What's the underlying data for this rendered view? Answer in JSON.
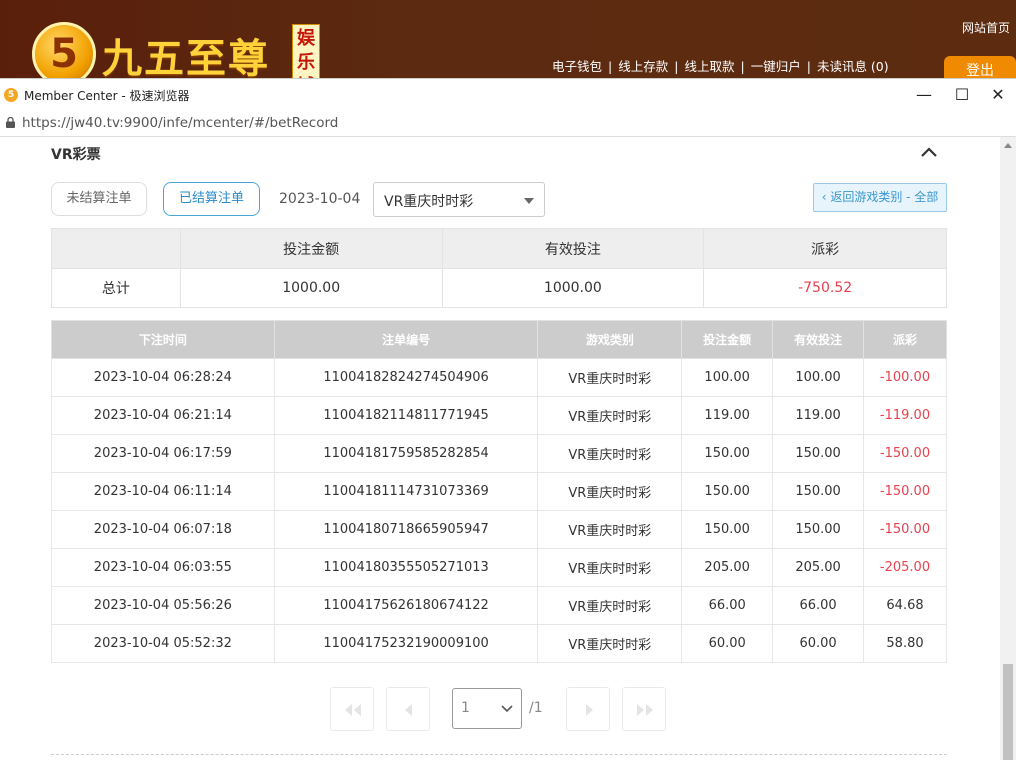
{
  "banner": {
    "logo_digit": "5",
    "logo_text": "九五至尊",
    "logo_badge": "娱乐城",
    "home_link": "网站首页",
    "nav": [
      "电子钱包",
      "线上存款",
      "线上取款",
      "一键归户",
      "未读讯息 (0)"
    ],
    "logout": "登出"
  },
  "window": {
    "title": "Member Center - 极速浏览器",
    "url": "https://jw40.tv:9900/infe/mcenter/#/betRecord",
    "minimize": "—",
    "maximize": "☐",
    "close": "✕"
  },
  "section": {
    "title": "VR彩票"
  },
  "filters": {
    "unsettled": "未结算注单",
    "settled": "已结算注单",
    "date": "2023-10-04",
    "game_select": "VR重庆时时彩",
    "back_button": "‹ 返回游戏类别 - 全部"
  },
  "summary": {
    "headers": [
      "",
      "投注金额",
      "有效投注",
      "派彩"
    ],
    "row": {
      "label": "总计",
      "bet": "1000.00",
      "valid": "1000.00",
      "payout": "-750.52"
    }
  },
  "records": {
    "headers": [
      "下注时间",
      "注单编号",
      "游戏类别",
      "投注金额",
      "有效投注",
      "派彩"
    ],
    "rows": [
      {
        "time": "2023-10-04 06:28:24",
        "id": "11004182824274504906",
        "game": "VR重庆时时彩",
        "bet": "100.00",
        "valid": "100.00",
        "payout": "-100.00"
      },
      {
        "time": "2023-10-04 06:21:14",
        "id": "11004182114811771945",
        "game": "VR重庆时时彩",
        "bet": "119.00",
        "valid": "119.00",
        "payout": "-119.00"
      },
      {
        "time": "2023-10-04 06:17:59",
        "id": "11004181759585282854",
        "game": "VR重庆时时彩",
        "bet": "150.00",
        "valid": "150.00",
        "payout": "-150.00"
      },
      {
        "time": "2023-10-04 06:11:14",
        "id": "11004181114731073369",
        "game": "VR重庆时时彩",
        "bet": "150.00",
        "valid": "150.00",
        "payout": "-150.00"
      },
      {
        "time": "2023-10-04 06:07:18",
        "id": "11004180718665905947",
        "game": "VR重庆时时彩",
        "bet": "150.00",
        "valid": "150.00",
        "payout": "-150.00"
      },
      {
        "time": "2023-10-04 06:03:55",
        "id": "11004180355505271013",
        "game": "VR重庆时时彩",
        "bet": "205.00",
        "valid": "205.00",
        "payout": "-205.00"
      },
      {
        "time": "2023-10-04 05:56:26",
        "id": "11004175626180674122",
        "game": "VR重庆时时彩",
        "bet": "66.00",
        "valid": "66.00",
        "payout": "64.68"
      },
      {
        "time": "2023-10-04 05:52:32",
        "id": "11004175232190009100",
        "game": "VR重庆时时彩",
        "bet": "60.00",
        "valid": "60.00",
        "payout": "58.80"
      }
    ]
  },
  "pagination": {
    "current": "1",
    "total": "/1"
  },
  "colors": {
    "negative": "#e8414d",
    "accent": "#2a8bc8",
    "banner": "#5a1f0b",
    "logout": "#f08a00"
  }
}
